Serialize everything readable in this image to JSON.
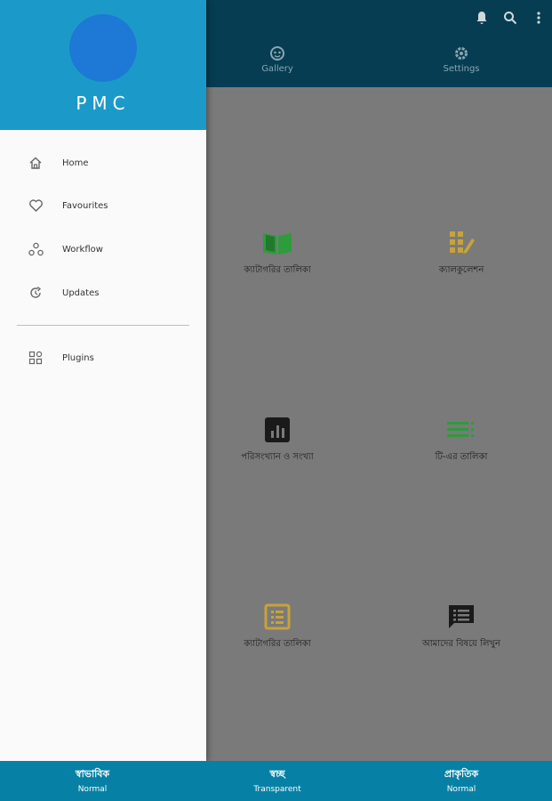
{
  "app": {
    "name": "PMC"
  },
  "topbar": {
    "tabs": [
      {
        "label": "Gallery",
        "icon": "gallery-icon"
      },
      {
        "label": "Settings",
        "icon": "gear-icon"
      }
    ],
    "actions": [
      "bell-icon",
      "search-icon",
      "more-vert-icon"
    ]
  },
  "drawer": {
    "items": [
      {
        "label": "Home",
        "icon": "home-icon"
      },
      {
        "label": "Favourites",
        "icon": "heart-icon"
      },
      {
        "label": "Workflow",
        "icon": "workflow-icon"
      },
      {
        "label": "Updates",
        "icon": "updates-icon"
      }
    ],
    "secondary": [
      {
        "label": "Plugins",
        "icon": "plugins-icon"
      }
    ]
  },
  "grid": [
    {
      "label": "ক্যাটাগরির তালিকা",
      "icon": "book-icon",
      "color": "#2e9b3c"
    },
    {
      "label": "ক্যালকুলেশন",
      "icon": "calculator-icon",
      "color": "#c8a23a"
    },
    {
      "label": "পরিসংখ্যান ও সংখ্যা",
      "icon": "chart-icon",
      "color": "#1a1a1a"
    },
    {
      "label": "টি-এর তালিকা",
      "icon": "list-icon",
      "color": "#2e9b3c"
    },
    {
      "label": "ক্যাটাগরির তালিকা",
      "icon": "list-box-icon",
      "color": "#c8a23a"
    },
    {
      "label": "আমাদের বিষয়ে লিখুন",
      "icon": "message-icon",
      "color": "#1a1a1a"
    }
  ],
  "bottom": [
    {
      "title": "স্বাভাবিক",
      "subtitle": "Normal"
    },
    {
      "title": "স্বচ্ছ",
      "subtitle": "Transparent"
    },
    {
      "title": "প্রাকৃতিক",
      "subtitle": "Normal"
    }
  ],
  "colors": {
    "topbar": "#063d52",
    "drawer_header": "#1b9ac9",
    "avatar": "#1d78d6",
    "bottom": "#0681a5"
  }
}
